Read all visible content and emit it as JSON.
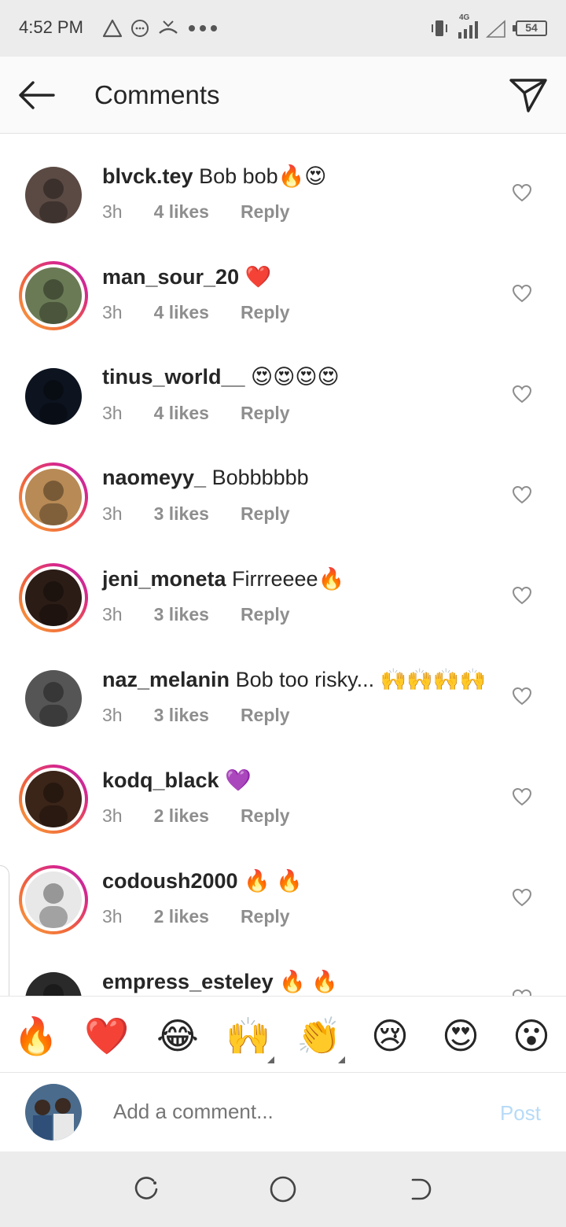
{
  "status_bar": {
    "time": "4:52 PM",
    "network": "4G",
    "battery": "54",
    "icons_left": [
      "warning-icon",
      "message-icon",
      "missed-call-icon",
      "more-dots-icon"
    ],
    "icons_right": [
      "vibrate-icon",
      "signal-icon",
      "signal-empty-icon",
      "battery-icon"
    ]
  },
  "header": {
    "title": "Comments",
    "back_icon": "arrow-left-icon",
    "share_icon": "paper-plane-icon"
  },
  "comments": [
    {
      "username": "blvck.tey",
      "text": " Bob bob🔥😍",
      "time": "3h",
      "likes": "4 likes",
      "reply": "Reply",
      "has_story_ring": false,
      "avatar_color": "#5b4a44"
    },
    {
      "username": "man_sour_20",
      "text": " ❤️",
      "time": "3h",
      "likes": "4 likes",
      "reply": "Reply",
      "has_story_ring": true,
      "avatar_color": "#6a7a55"
    },
    {
      "username": "tinus_world__",
      "text": " 😍😍😍😍",
      "time": "3h",
      "likes": "4 likes",
      "reply": "Reply",
      "has_story_ring": false,
      "avatar_color": "#0d1420"
    },
    {
      "username": "naomeyy_",
      "text": " Bobbbbbb",
      "time": "3h",
      "likes": "3 likes",
      "reply": "Reply",
      "has_story_ring": true,
      "avatar_color": "#b88a55"
    },
    {
      "username": "jeni_moneta",
      "text": " Firrreeee🔥",
      "time": "3h",
      "likes": "3 likes",
      "reply": "Reply",
      "has_story_ring": true,
      "avatar_color": "#2b1c16"
    },
    {
      "username": "naz_melanin",
      "text": " Bob too risky... 🙌🙌🙌🙌",
      "time": "3h",
      "likes": "3 likes",
      "reply": "Reply",
      "has_story_ring": false,
      "avatar_color": "#555555"
    },
    {
      "username": "kodq_black",
      "text": " 💜",
      "time": "3h",
      "likes": "2 likes",
      "reply": "Reply",
      "has_story_ring": true,
      "avatar_color": "#3b2418"
    },
    {
      "username": "codoush2000",
      "text": " 🔥 🔥",
      "time": "3h",
      "likes": "2 likes",
      "reply": "Reply",
      "has_story_ring": true,
      "avatar_color": "#e8e8e8"
    },
    {
      "username": "empress_esteley",
      "text": " 🔥 🔥",
      "time": "",
      "likes": "",
      "reply": "",
      "has_story_ring": false,
      "avatar_color": "#2a2a2a"
    }
  ],
  "emoji_bar": {
    "emojis": [
      "🔥",
      "❤️",
      "😂",
      "🙌",
      "👏",
      "😢",
      "😍",
      "😮"
    ]
  },
  "composer": {
    "placeholder": "Add a comment...",
    "post_label": "Post",
    "post_color": "#b7dbf7"
  },
  "nav_bar": {
    "icons": [
      "recent-apps-icon",
      "home-icon",
      "back-nav-icon"
    ]
  }
}
